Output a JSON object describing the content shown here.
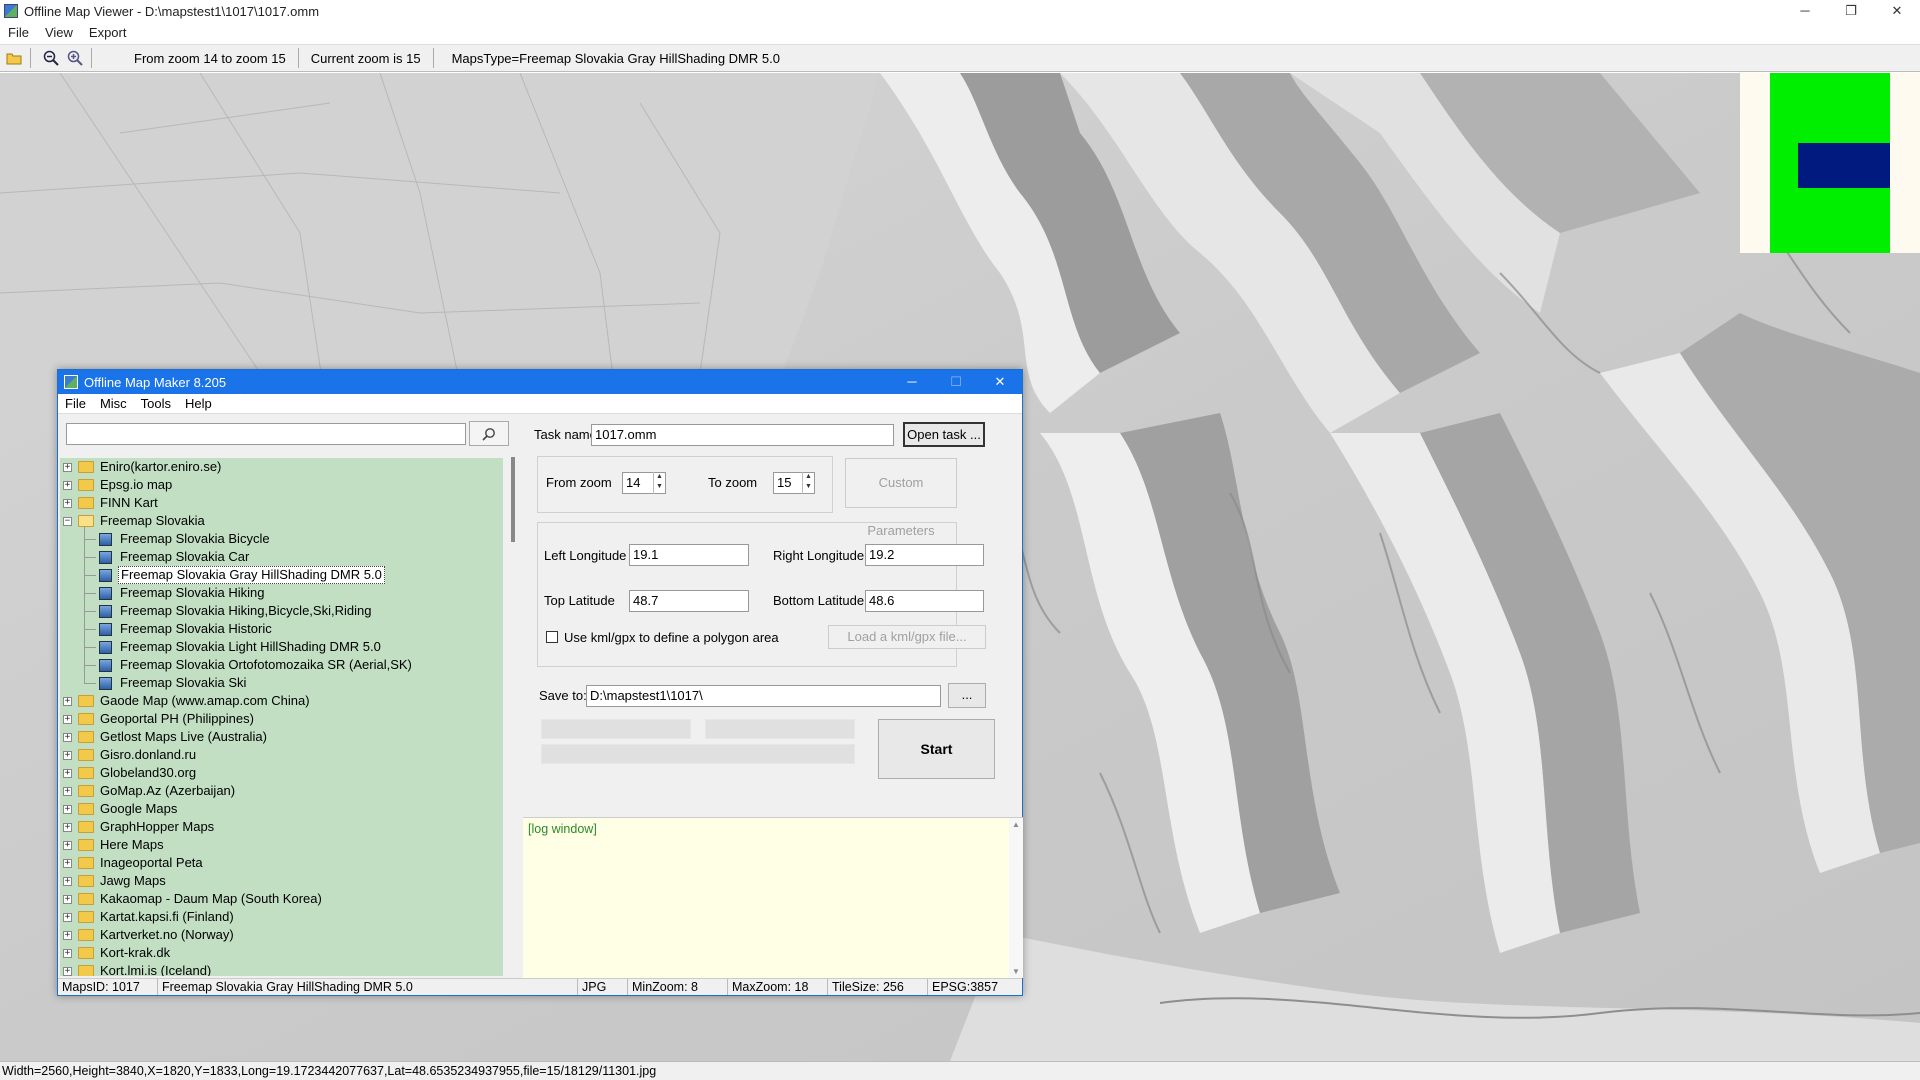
{
  "main_window": {
    "title": "Offline Map Viewer - D:\\mapstest1\\1017\\1017.omm",
    "controls": {
      "minimize": "─",
      "restore": "❐",
      "close": "✕"
    },
    "menu": [
      "File",
      "View",
      "Export"
    ],
    "toolbar": {
      "zoom_range": "From zoom 14 to zoom 15",
      "current_zoom": "Current zoom is 15",
      "maps_type": "MapsType=Freemap Slovakia Gray HillShading DMR 5.0"
    },
    "status": "Width=2560,Height=3840,X=1820,Y=1833,Long=19.1723442077637,Lat=48.6535234937955,file=15/18129/11301.jpg"
  },
  "minimap": {
    "bg_color": "#fffaf0",
    "region_color": "#00ee00",
    "view_color": "#001a80"
  },
  "dialog": {
    "title": "Offline Map Maker 8.205",
    "controls": {
      "minimize": "─",
      "maximize": "☐",
      "close": "✕"
    },
    "menu": [
      "File",
      "Misc",
      "Tools",
      "Help"
    ],
    "search": {
      "value": "",
      "button_icon": "search-icon"
    },
    "tree": [
      {
        "label": "Eniro(kartor.eniro.se)",
        "level": 0,
        "expanded": false
      },
      {
        "label": "Epsg.io map",
        "level": 0,
        "expanded": false
      },
      {
        "label": "FINN Kart",
        "level": 0,
        "expanded": false
      },
      {
        "label": "Freemap Slovakia",
        "level": 0,
        "expanded": true
      },
      {
        "label": "Freemap Slovakia Bicycle",
        "level": 1
      },
      {
        "label": "Freemap Slovakia Car",
        "level": 1
      },
      {
        "label": "Freemap Slovakia Gray HillShading DMR 5.0",
        "level": 1,
        "selected": true
      },
      {
        "label": "Freemap Slovakia Hiking",
        "level": 1
      },
      {
        "label": "Freemap Slovakia Hiking,Bicycle,Ski,Riding",
        "level": 1
      },
      {
        "label": "Freemap Slovakia Historic",
        "level": 1
      },
      {
        "label": "Freemap Slovakia Light HillShading DMR 5.0",
        "level": 1
      },
      {
        "label": "Freemap Slovakia Ortofotomozaika SR (Aerial,SK)",
        "level": 1
      },
      {
        "label": "Freemap Slovakia Ski",
        "level": 1
      },
      {
        "label": "Gaode Map (www.amap.com China)",
        "level": 0,
        "expanded": false
      },
      {
        "label": "Geoportal PH (Philippines)",
        "level": 0,
        "expanded": false
      },
      {
        "label": "Getlost Maps Live (Australia)",
        "level": 0,
        "expanded": false
      },
      {
        "label": "Gisro.donland.ru",
        "level": 0,
        "expanded": false
      },
      {
        "label": "Globeland30.org",
        "level": 0,
        "expanded": false
      },
      {
        "label": "GoMap.Az (Azerbaijan)",
        "level": 0,
        "expanded": false
      },
      {
        "label": "Google Maps",
        "level": 0,
        "expanded": false
      },
      {
        "label": "GraphHopper Maps",
        "level": 0,
        "expanded": false
      },
      {
        "label": "Here Maps",
        "level": 0,
        "expanded": false
      },
      {
        "label": "Inageoportal Peta",
        "level": 0,
        "expanded": false
      },
      {
        "label": "Jawg Maps",
        "level": 0,
        "expanded": false
      },
      {
        "label": "Kakaomap - Daum Map (South Korea)",
        "level": 0,
        "expanded": false
      },
      {
        "label": "Kartat.kapsi.fi (Finland)",
        "level": 0,
        "expanded": false
      },
      {
        "label": "Kartverket.no (Norway)",
        "level": 0,
        "expanded": false
      },
      {
        "label": "Kort-krak.dk",
        "level": 0,
        "expanded": false
      },
      {
        "label": "Kort.lmi.is (Iceland)",
        "level": 0,
        "expanded": false
      }
    ],
    "task": {
      "name_label": "Task name",
      "name_value": "1017.omm",
      "open_button": "Open task ...",
      "from_zoom_label": "From zoom",
      "from_zoom_value": "14",
      "to_zoom_label": "To zoom",
      "to_zoom_value": "15",
      "custom_params_button": "Custom Parameters",
      "left_longitude_label": "Left Longitude",
      "left_longitude_value": "19.1",
      "right_longitude_label": "Right Longitude",
      "right_longitude_value": "19.2",
      "top_latitude_label": "Top Latitude",
      "top_latitude_value": "48.7",
      "bottom_latitude_label": "Bottom Latitude",
      "bottom_latitude_value": "48.6",
      "kml_checkbox_label": "Use kml/gpx to define a polygon area",
      "kml_checked": false,
      "load_kml_button": "Load a kml/gpx file...",
      "save_to_label": "Save to:",
      "save_to_value": "D:\\mapstest1\\1017\\",
      "browse_button": "...",
      "start_button": "Start"
    },
    "log": {
      "text": "[log window]"
    },
    "status": {
      "maps_id": "MapsID: 1017",
      "maps_name": "Freemap Slovakia Gray HillShading DMR 5.0",
      "format": "JPG",
      "min_zoom": "MinZoom: 8",
      "max_zoom": "MaxZoom: 18",
      "tile_size": "TileSize: 256",
      "epsg": "EPSG:3857"
    }
  }
}
